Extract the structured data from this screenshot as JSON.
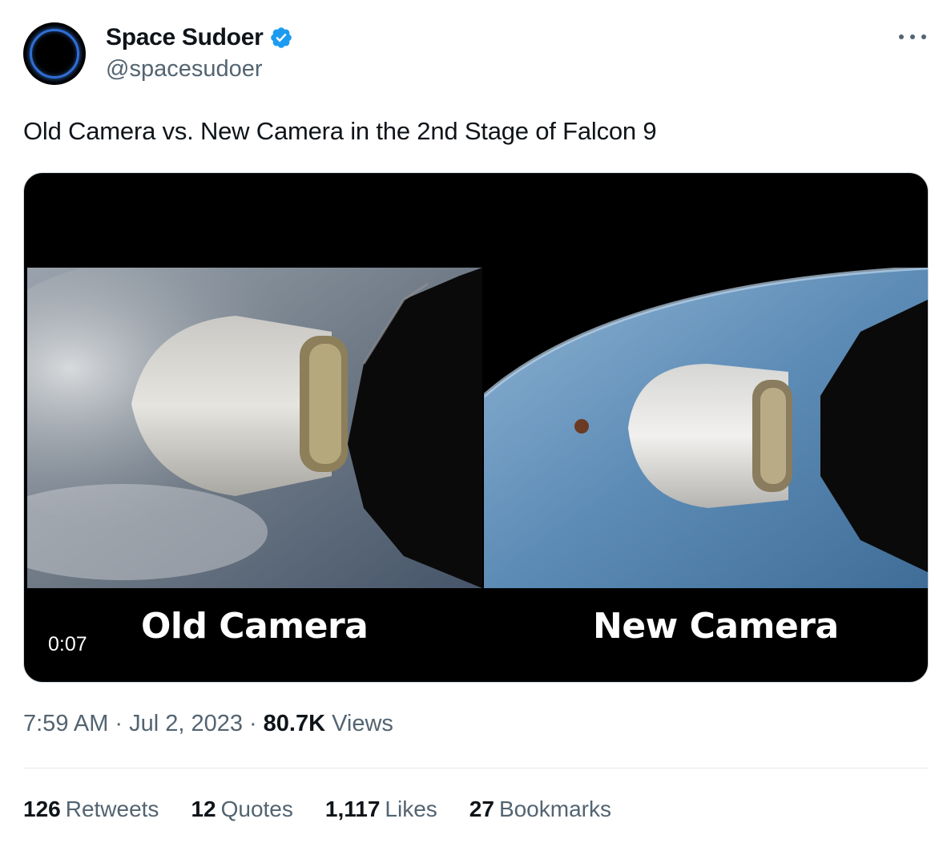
{
  "author": {
    "display_name": "Space Sudoer",
    "handle": "@spacesudoer",
    "verified_icon": "verified-badge-icon",
    "badge_color": "#1d9bf0"
  },
  "tweet": {
    "text": "Old Camera vs. New Camera in the 2nd Stage of Falcon 9"
  },
  "media": {
    "type": "video",
    "timer": "0:07",
    "left_caption": "Old Camera",
    "right_caption": "New Camera"
  },
  "meta": {
    "time": "7:59 AM",
    "date": "Jul 2, 2023",
    "separator": "·",
    "views_count": "80.7K",
    "views_label": "Views"
  },
  "stats": [
    {
      "count": "126",
      "label": "Retweets"
    },
    {
      "count": "12",
      "label": "Quotes"
    },
    {
      "count": "1,117",
      "label": "Likes"
    },
    {
      "count": "27",
      "label": "Bookmarks"
    }
  ],
  "colors": {
    "text_primary": "#0f1419",
    "text_secondary": "#536471",
    "accent": "#1d9bf0"
  }
}
